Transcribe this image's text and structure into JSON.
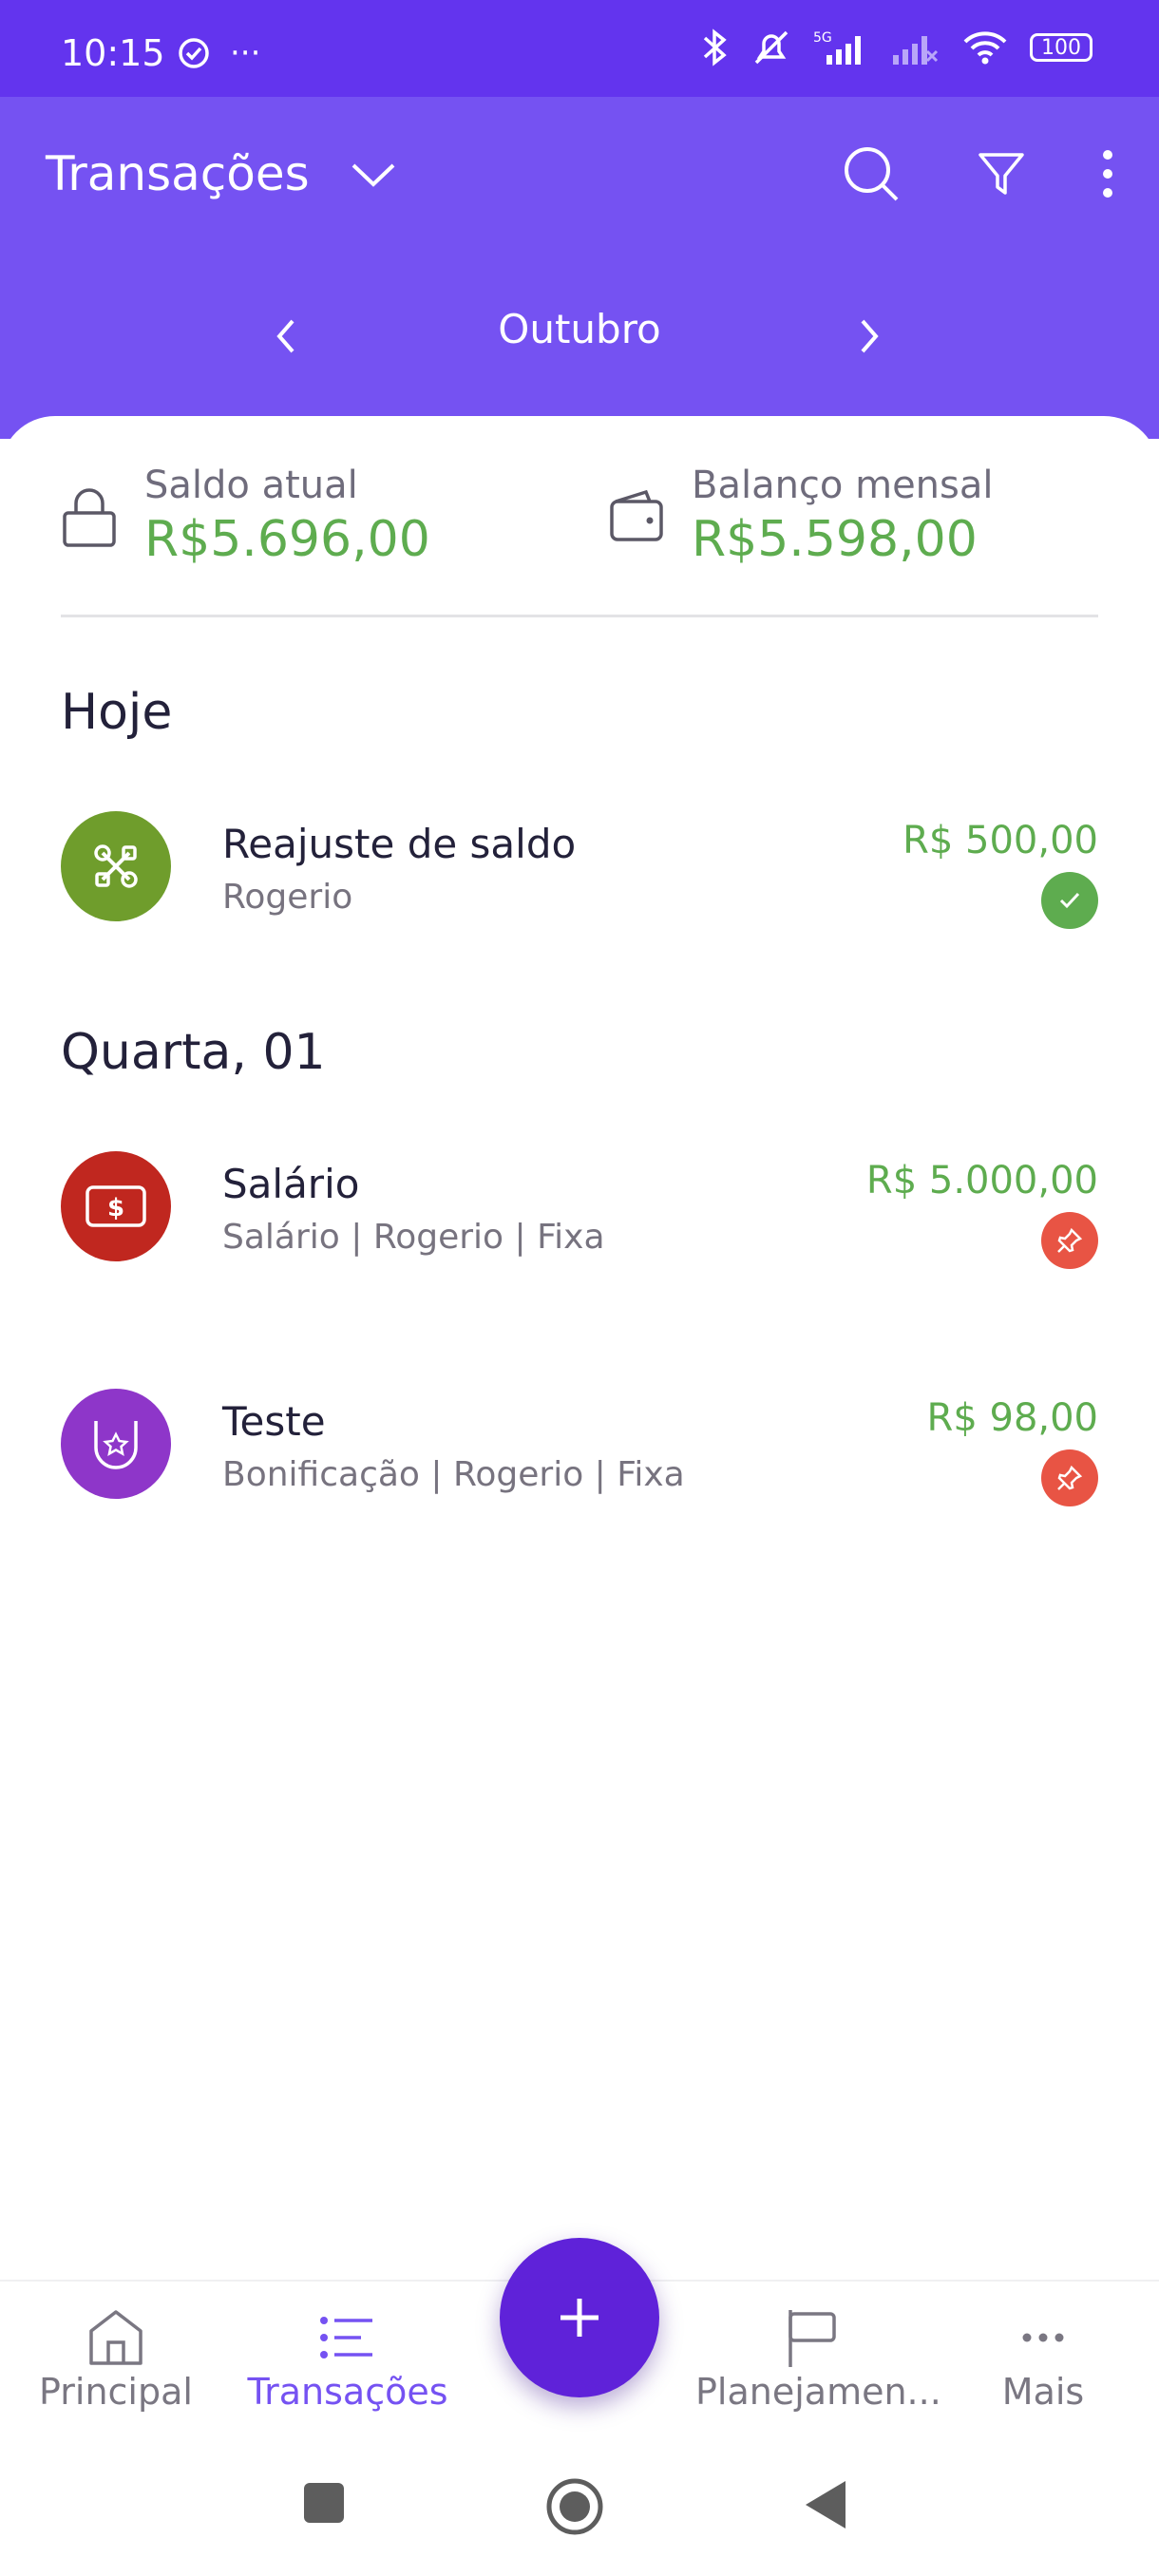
{
  "status_bar": {
    "time": "10:15",
    "more": "···",
    "battery": "100"
  },
  "header": {
    "title": "Transações",
    "month": "Outubro"
  },
  "balances": {
    "current_label": "Saldo atual",
    "current_value": "R$5.696,00",
    "monthly_label": "Balanço mensal",
    "monthly_value": "R$5.598,00"
  },
  "sections": [
    {
      "title": "Hoje",
      "transactions": [
        {
          "title": "Reajuste de saldo",
          "subtitle": "Rogerio",
          "amount": "R$ 500,00",
          "icon": "tools-icon",
          "icon_color": "#6f9d2c",
          "status": "confirmed",
          "status_color": "#5eac4f"
        }
      ]
    },
    {
      "title": "Quarta, 01",
      "transactions": [
        {
          "title": "Salário",
          "subtitle": "Salário | Rogerio  | Fixa",
          "amount": "R$ 5.000,00",
          "icon": "money-icon",
          "icon_color": "#c0271f",
          "status": "pinned",
          "status_color": "#e85444"
        },
        {
          "title": "Teste",
          "subtitle": "Bonificação | Rogerio  | Fixa",
          "amount": "R$ 98,00",
          "icon": "badge-star-icon",
          "icon_color": "#8e36c9",
          "status": "pinned",
          "status_color": "#e85444"
        }
      ]
    }
  ],
  "bottom_nav": {
    "items": [
      {
        "label": "Principal",
        "icon": "home-icon"
      },
      {
        "label": "Transações",
        "icon": "list-icon",
        "active": true
      },
      {
        "label": "Planejamen...",
        "icon": "flag-icon"
      },
      {
        "label": "Mais",
        "icon": "more-icon"
      }
    ],
    "fab": "+"
  },
  "colors": {
    "status_bar": "#6334ee",
    "header": "#7552f2",
    "income_green": "#5eac4f",
    "fab": "#5f22d9"
  }
}
